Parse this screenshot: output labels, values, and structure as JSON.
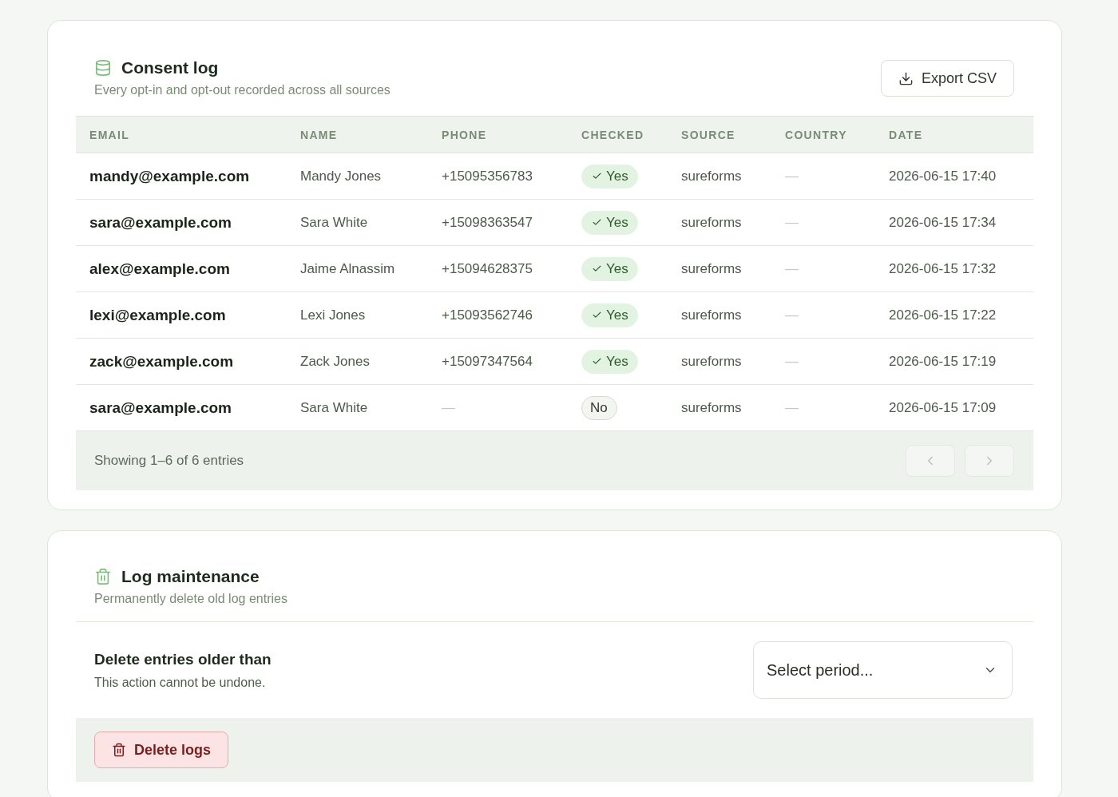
{
  "consent_log": {
    "title": "Consent log",
    "subtitle": "Every opt-in and opt-out recorded across all sources",
    "export_button": {
      "label": "Export CSV"
    },
    "table": {
      "columns": [
        "EMAIL",
        "NAME",
        "PHONE",
        "CHECKED",
        "SOURCE",
        "COUNTRY",
        "DATE"
      ],
      "rows": [
        {
          "email": "mandy@example.com",
          "name": "Mandy Jones",
          "phone": {
            "text": "+15095356783",
            "empty": false
          },
          "checked": {
            "label": "Yes",
            "on": true
          },
          "source": "sureforms",
          "country": {
            "text": "—",
            "empty": true
          },
          "date": "2026-06-15 17:40"
        },
        {
          "email": "sara@example.com",
          "name": "Sara White",
          "phone": {
            "text": "+15098363547",
            "empty": false
          },
          "checked": {
            "label": "Yes",
            "on": true
          },
          "source": "sureforms",
          "country": {
            "text": "—",
            "empty": true
          },
          "date": "2026-06-15 17:34"
        },
        {
          "email": "alex@example.com",
          "name": "Jaime Alnassim",
          "phone": {
            "text": "+15094628375",
            "empty": false
          },
          "checked": {
            "label": "Yes",
            "on": true
          },
          "source": "sureforms",
          "country": {
            "text": "—",
            "empty": true
          },
          "date": "2026-06-15 17:32"
        },
        {
          "email": "lexi@example.com",
          "name": "Lexi Jones",
          "phone": {
            "text": "+15093562746",
            "empty": false
          },
          "checked": {
            "label": "Yes",
            "on": true
          },
          "source": "sureforms",
          "country": {
            "text": "—",
            "empty": true
          },
          "date": "2026-06-15 17:22"
        },
        {
          "email": "zack@example.com",
          "name": "Zack Jones",
          "phone": {
            "text": "+15097347564",
            "empty": false
          },
          "checked": {
            "label": "Yes",
            "on": true
          },
          "source": "sureforms",
          "country": {
            "text": "—",
            "empty": true
          },
          "date": "2026-06-15 17:19"
        },
        {
          "email": "sara@example.com",
          "name": "Sara White",
          "phone": {
            "text": "—",
            "empty": true
          },
          "checked": {
            "label": "No",
            "on": false
          },
          "source": "sureforms",
          "country": {
            "text": "—",
            "empty": true
          },
          "date": "2026-06-15 17:09"
        }
      ]
    },
    "footer": {
      "summary": "Showing 1–6 of 6 entries",
      "pagination": [
        {
          "kind": "previous",
          "disabled": true
        },
        {
          "kind": "next",
          "disabled": true
        }
      ]
    }
  },
  "log_maintenance": {
    "title": "Log maintenance",
    "subtitle": "Permanently delete old log entries",
    "setting": {
      "label": "Delete entries older than",
      "description": "This action cannot be undone.",
      "select": {
        "placeholder": "Select period..."
      }
    },
    "delete_button": {
      "label": "Delete logs"
    }
  }
}
